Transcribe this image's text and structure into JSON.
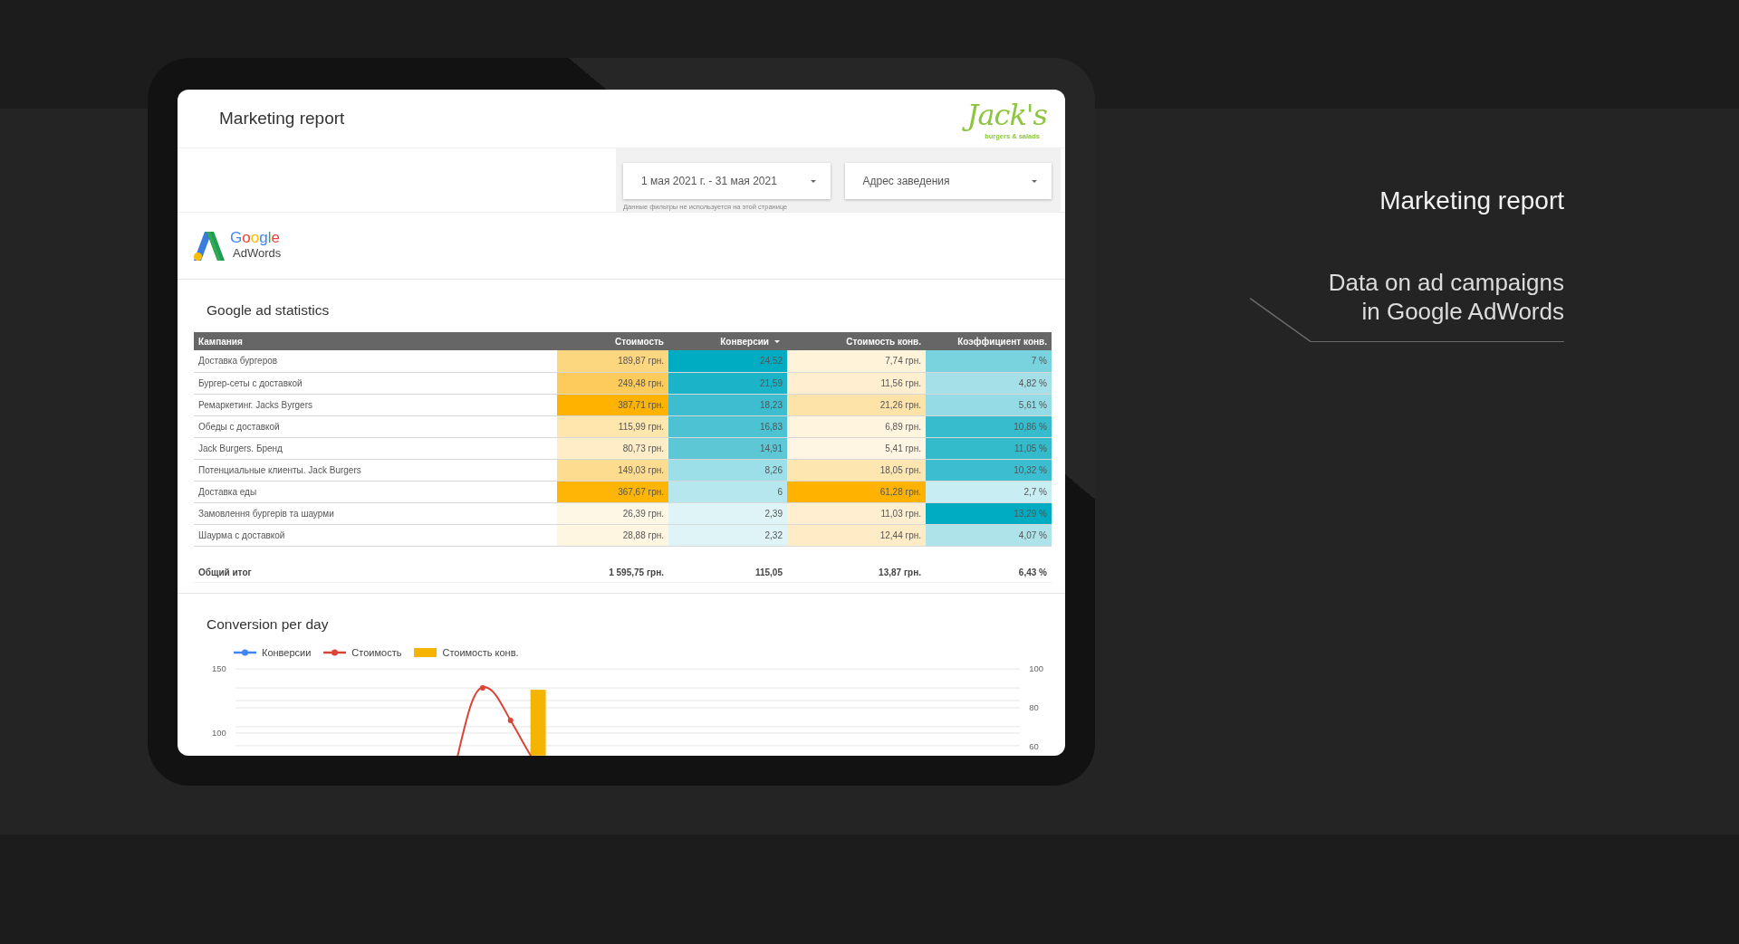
{
  "page": {
    "title": "Marketing report",
    "subtitle": "Data on ad campaigns in Google AdWords"
  },
  "report": {
    "title": "Marketing report",
    "logo": {
      "name": "Jack's",
      "tagline": "burgers & salads"
    },
    "filters": [
      {
        "value": "1 мая 2021 г. - 31 мая 2021"
      },
      {
        "value": "Адрес заведения"
      }
    ],
    "filter_note": "Данные фильтры не используется на этой странице",
    "source_logo": {
      "brand": "Google",
      "product": "AdWords"
    },
    "statistics": {
      "title": "Google ad statistics",
      "columns": [
        {
          "label": "Кампания",
          "sorted": false
        },
        {
          "label": "Стоимость",
          "sorted": false
        },
        {
          "label": "Конверсии",
          "sorted": true
        },
        {
          "label": "Стоимость конв.",
          "sorted": false
        },
        {
          "label": "Коэффициент конв.",
          "sorted": false
        }
      ],
      "rows": [
        {
          "campaign": "Доставка бургеров",
          "values": [
            {
              "text": "189,87 грн.",
              "color": "#fdd780"
            },
            {
              "text": "24,52",
              "color": "#00acc1"
            },
            {
              "text": "7,74 грн.",
              "color": "#fff3da"
            },
            {
              "text": "7 %",
              "color": "#79d3df"
            }
          ]
        },
        {
          "campaign": "Бургер-сеты с доставкой",
          "values": [
            {
              "text": "249,48 грн.",
              "color": "#fdca5c"
            },
            {
              "text": "21,59",
              "color": "#1bb3c7"
            },
            {
              "text": "11,56 грн.",
              "color": "#ffefd0"
            },
            {
              "text": "4,82 %",
              "color": "#a5e0e8"
            }
          ]
        },
        {
          "campaign": "Ремаркетинг. Jacks Byrgers",
          "values": [
            {
              "text": "387,71 грн.",
              "color": "#ffb300"
            },
            {
              "text": "18,23",
              "color": "#3dbdcf"
            },
            {
              "text": "21,26 грн.",
              "color": "#fee3a8"
            },
            {
              "text": "5,61 %",
              "color": "#94dbe5"
            }
          ]
        },
        {
          "campaign": "Обеды с доставкой",
          "values": [
            {
              "text": "115,99 грн.",
              "color": "#fee6ac"
            },
            {
              "text": "16,83",
              "color": "#4cc2d3"
            },
            {
              "text": "6,89 грн.",
              "color": "#fff4de"
            },
            {
              "text": "10,86 %",
              "color": "#36bccd"
            }
          ]
        },
        {
          "campaign": "Jack Burgers. Бренд",
          "values": [
            {
              "text": "80,73 грн.",
              "color": "#feedc6"
            },
            {
              "text": "14,91",
              "color": "#5dc7d6"
            },
            {
              "text": "5,41 грн.",
              "color": "#fff5e2"
            },
            {
              "text": "11,05 %",
              "color": "#33bbcc"
            }
          ]
        },
        {
          "campaign": "Потенциальные клиенты. Jack Burgers",
          "values": [
            {
              "text": "149,03 грн.",
              "color": "#fddc90"
            },
            {
              "text": "8,26",
              "color": "#9ddfe8"
            },
            {
              "text": "18,05 грн.",
              "color": "#fee6b0"
            },
            {
              "text": "10,32 %",
              "color": "#3dbed0"
            }
          ]
        },
        {
          "campaign": "Доставка еды",
          "values": [
            {
              "text": "367,67 грн.",
              "color": "#feb506"
            },
            {
              "text": "6",
              "color": "#b6e7ee"
            },
            {
              "text": "61,28 грн.",
              "color": "#ffb300"
            },
            {
              "text": "2,7 %",
              "color": "#c8edf2"
            }
          ]
        },
        {
          "campaign": "Замовлення бургерів та шаурми",
          "values": [
            {
              "text": "26,39 грн.",
              "color": "#fff7e5"
            },
            {
              "text": "2,39",
              "color": "#def4f7"
            },
            {
              "text": "11,03 грн.",
              "color": "#ffefd0"
            },
            {
              "text": "13,29 %",
              "color": "#00acc1"
            }
          ]
        },
        {
          "campaign": "Шаурма с доставкой",
          "values": [
            {
              "text": "28,88 грн.",
              "color": "#fff6e2"
            },
            {
              "text": "2,32",
              "color": "#def4f7"
            },
            {
              "text": "12,44 грн.",
              "color": "#ffecc6"
            },
            {
              "text": "4,07 %",
              "color": "#aee3ea"
            }
          ]
        }
      ],
      "total": {
        "label": "Общий итог",
        "values": [
          "1 595,75 грн.",
          "115,05",
          "13,87 грн.",
          "6,43 %"
        ]
      }
    },
    "chart": {
      "title": "Conversion per day",
      "legend": [
        {
          "label": "Конверсии",
          "kind": "line",
          "color": "#4285f4"
        },
        {
          "label": "Стоимость",
          "kind": "line",
          "color": "#db4437"
        },
        {
          "label": "Стоимость конв.",
          "kind": "bar",
          "color": "#f4b400"
        }
      ],
      "left_axis": [
        "150",
        "100"
      ],
      "right_axis": [
        "100",
        "80",
        "60"
      ]
    }
  }
}
